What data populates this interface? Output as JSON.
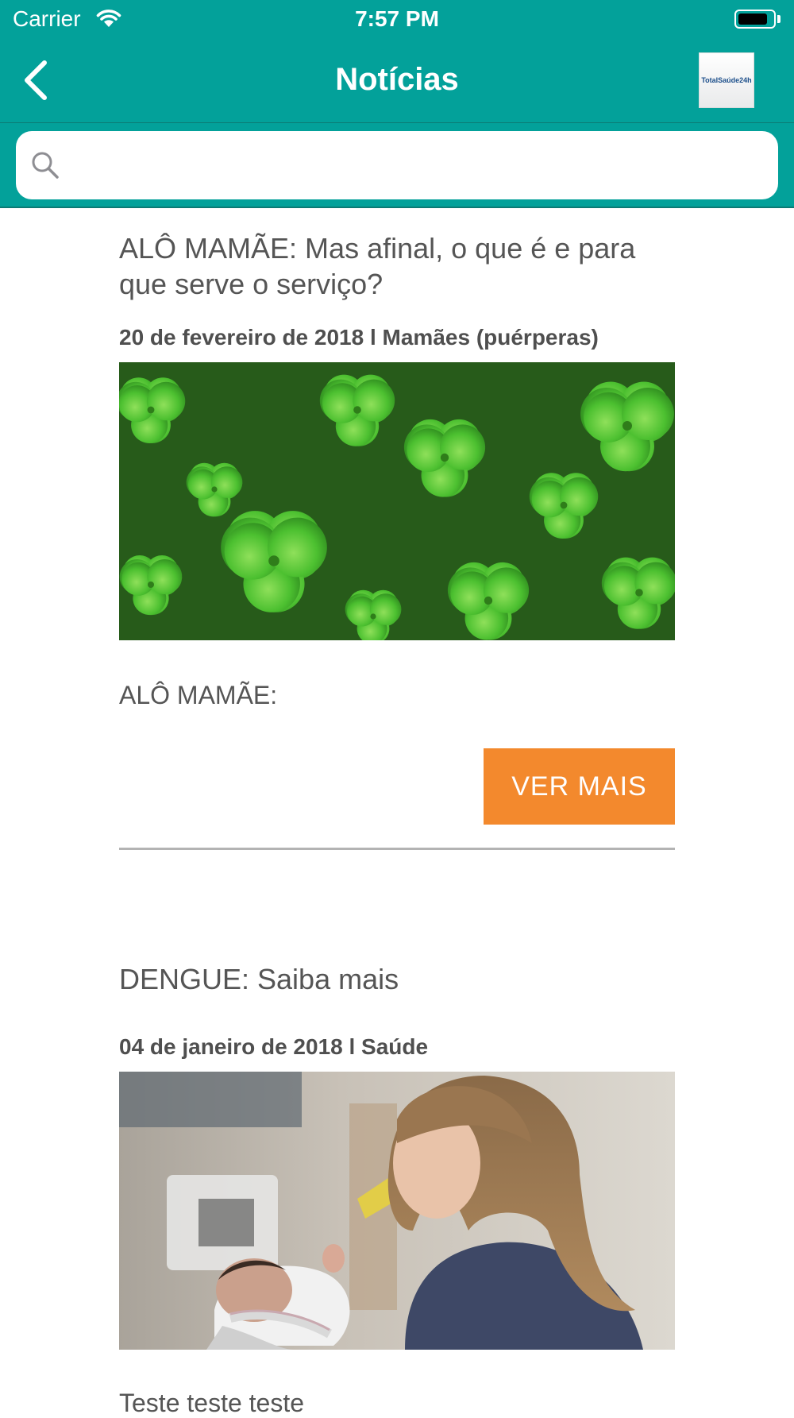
{
  "status_bar": {
    "carrier": "Carrier",
    "time": "7:57 PM",
    "battery_level": 0.85
  },
  "nav": {
    "title": "Notícias",
    "back_icon": "chevron-left-icon",
    "logo_text": "TotalSaúde24h"
  },
  "search": {
    "icon": "search-icon",
    "placeholder": "",
    "value": ""
  },
  "articles": [
    {
      "headline": "ALÔ MAMÃE: Mas afinal, o que é e para que serve o serviço?",
      "meta": "20 de fevereiro de 2018 l Mamães (puérperas)",
      "image": "clover-leaves-photo",
      "excerpt": "ALÔ MAMÃE:",
      "button_label": "VER MAIS"
    },
    {
      "headline": "DENGUE: Saiba mais",
      "meta": "04 de janeiro de 2018 l Saúde",
      "image": "nurse-holding-newborn-photo",
      "excerpt": "Teste teste teste"
    }
  ],
  "colors": {
    "header": "#03a19a",
    "button": "#f3892d",
    "text": "#555555"
  }
}
